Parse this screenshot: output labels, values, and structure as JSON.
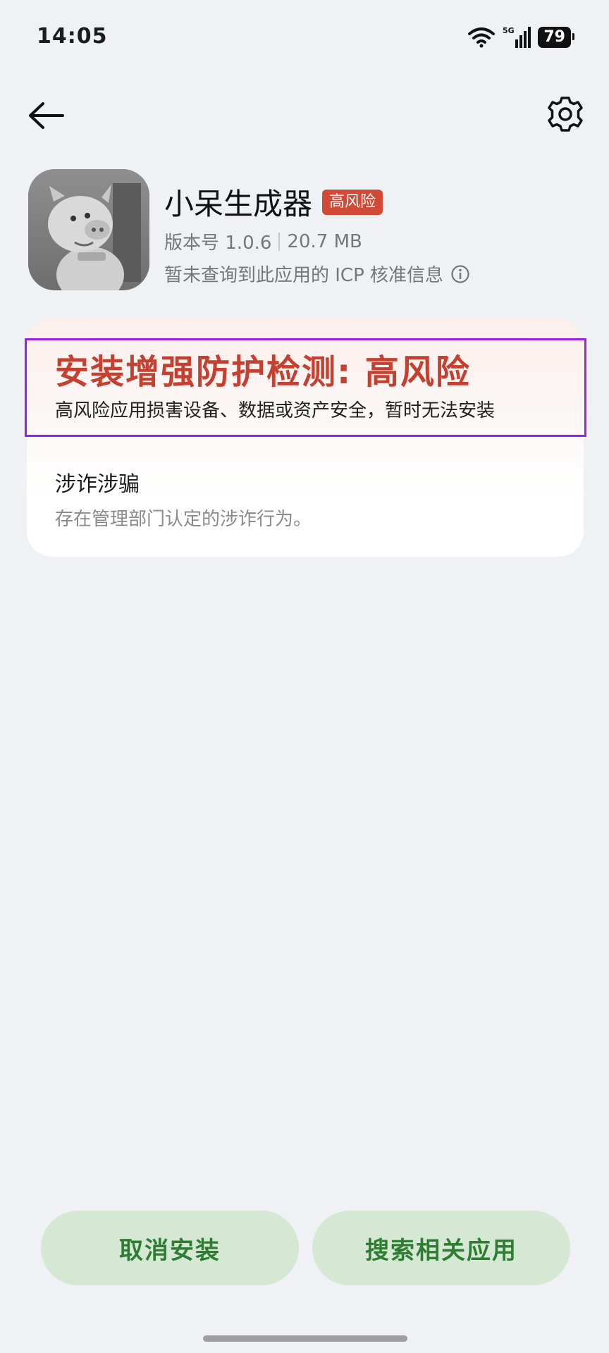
{
  "status_bar": {
    "time": "14:05",
    "network": "5G",
    "battery": "79"
  },
  "nav": {
    "back_icon": "arrow-left-icon",
    "settings_icon": "gear-icon"
  },
  "app": {
    "name": "小呆生成器",
    "risk_badge": "高风险",
    "version": "版本号 1.0.6",
    "size": "20.7 MB",
    "icp_notice": "暂未查询到此应用的 ICP 核准信息"
  },
  "risk_card": {
    "title": "安装增强防护检测: 高风险",
    "description": "高风险应用损害设备、数据或资产安全，暂时无法安装",
    "issue_title": "涉诈涉骗",
    "issue_description": "存在管理部门认定的涉诈行为。"
  },
  "buttons": {
    "cancel_install": "取消安装",
    "search_related": "搜索相关应用"
  },
  "colors": {
    "background": "#f0f1f5",
    "risk_red": "#c44030",
    "badge_red": "#d14a35",
    "button_green_bg": "#d4e8d3",
    "button_green_text": "#2e7d32",
    "highlight_purple": "#9a20ee"
  }
}
